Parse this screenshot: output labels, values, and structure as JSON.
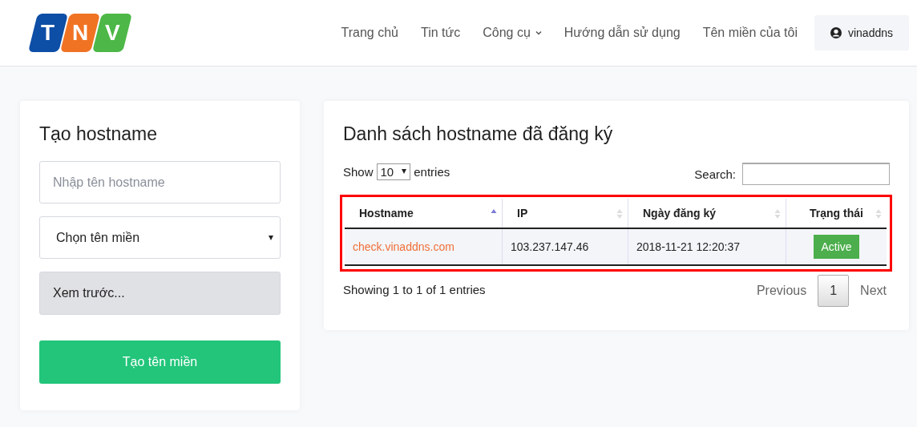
{
  "logo": {
    "letters": [
      {
        "text": "T",
        "color": "#0d4ea6"
      },
      {
        "text": "N",
        "color": "#f07323"
      },
      {
        "text": "V",
        "color": "#4db748"
      }
    ]
  },
  "nav": {
    "items": [
      {
        "label": "Trang chủ",
        "kind": "link"
      },
      {
        "label": "Tin tức",
        "kind": "link"
      },
      {
        "label": "Công cụ",
        "kind": "dropdown"
      },
      {
        "label": "Hướng dẫn sử dụng",
        "kind": "link"
      },
      {
        "label": "Tên miền của tôi",
        "kind": "link"
      }
    ],
    "user": "vinaddns"
  },
  "create_card": {
    "title": "Tạo hostname",
    "hostname_field": {
      "placeholder": "Nhập tên hostname"
    },
    "domain_select": {
      "value": "Chọn tên miền"
    },
    "preview": "Xem trước...",
    "submit": "Tạo tên miền"
  },
  "list_card": {
    "title": "Danh sách hostname đã đăng ký",
    "show_label": "Show",
    "page_size": "10",
    "entries_label": "entries",
    "search_label": "Search:",
    "columns": [
      {
        "label": "Hostname",
        "sorted": true
      },
      {
        "label": "IP",
        "sorted": false
      },
      {
        "label": "Ngày đăng ký",
        "sorted": false
      },
      {
        "label": "Trạng thái",
        "sorted": false
      }
    ],
    "rows": [
      {
        "hostname": "check.vinaddns.com",
        "ip": "103.237.147.46",
        "date": "2018-11-21 12:20:37",
        "status": "Active"
      }
    ],
    "info": "Showing 1 to 1 of 1 entries",
    "pagination": {
      "previous": "Previous",
      "pages": [
        {
          "label": "1",
          "selected": true
        }
      ],
      "next": "Next"
    }
  }
}
